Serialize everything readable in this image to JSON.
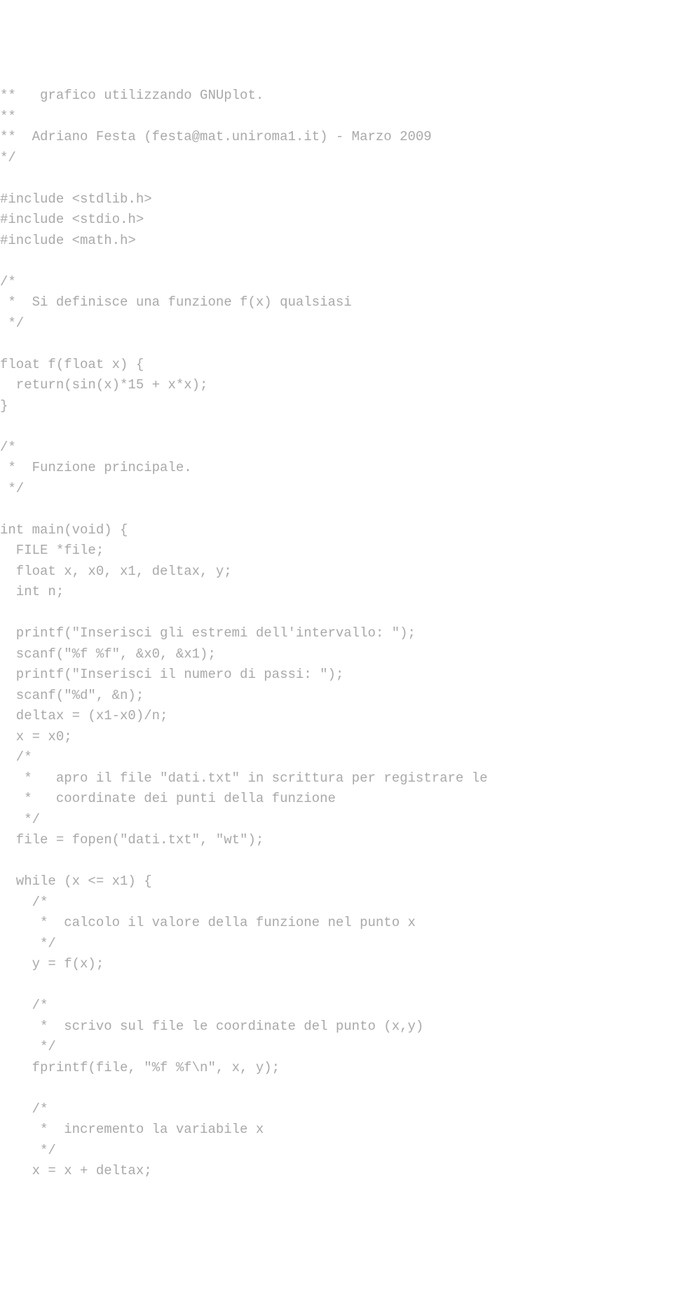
{
  "code_lines": [
    "**   grafico utilizzando GNUplot.",
    "**",
    "**  Adriano Festa (festa@mat.uniroma1.it) - Marzo 2009",
    "*/",
    "",
    "#include <stdlib.h>",
    "#include <stdio.h>",
    "#include <math.h>",
    "",
    "/*",
    " *  Si definisce una funzione f(x) qualsiasi",
    " */",
    "",
    "float f(float x) {",
    "  return(sin(x)*15 + x*x);",
    "}",
    "",
    "/*",
    " *  Funzione principale.",
    " */",
    "",
    "int main(void) {",
    "  FILE *file;",
    "  float x, x0, x1, deltax, y;",
    "  int n;",
    "",
    "  printf(\"Inserisci gli estremi dell'intervallo: \");",
    "  scanf(\"%f %f\", &x0, &x1);",
    "  printf(\"Inserisci il numero di passi: \");",
    "  scanf(\"%d\", &n);",
    "  deltax = (x1-x0)/n;",
    "  x = x0;",
    "  /*",
    "   *   apro il file \"dati.txt\" in scrittura per registrare le",
    "   *   coordinate dei punti della funzione",
    "   */",
    "  file = fopen(\"dati.txt\", \"wt\");",
    "",
    "  while (x <= x1) {",
    "    /*",
    "     *  calcolo il valore della funzione nel punto x",
    "     */",
    "    y = f(x);",
    "",
    "    /*",
    "     *  scrivo sul file le coordinate del punto (x,y)",
    "     */",
    "    fprintf(file, \"%f %f\\n\", x, y);",
    "",
    "    /*",
    "     *  incremento la variabile x",
    "     */",
    "    x = x + deltax;"
  ]
}
